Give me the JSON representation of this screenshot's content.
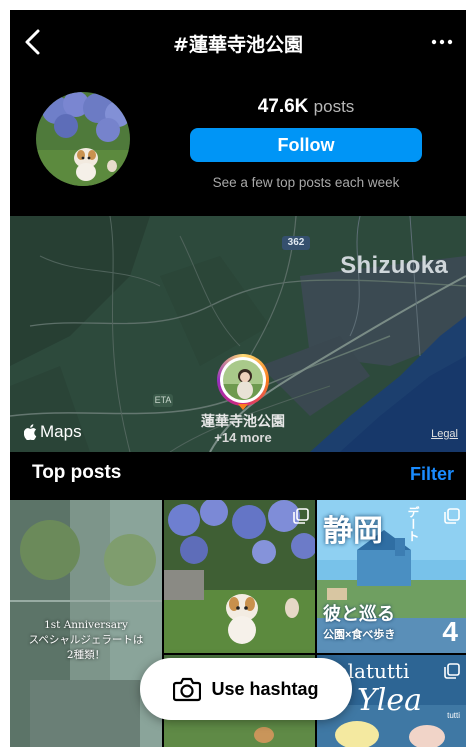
{
  "header": {
    "title": "#蓮華寺池公園",
    "back_icon": "chevron-left-icon",
    "more_icon": "more-horizontal-icon"
  },
  "profile": {
    "posts_count": "47.6K",
    "posts_label": "posts",
    "follow_label": "Follow",
    "follow_hint": "See a few top posts each week"
  },
  "map": {
    "city_label": "Shizuoka",
    "road_number": "362",
    "eta_label": "ETA",
    "place_name": "蓮華寺池公園",
    "place_more": "+14 more",
    "maps_label": "Maps",
    "legal_label": "Legal"
  },
  "top_posts": {
    "heading": "Top posts",
    "filter_label": "Filter",
    "tile1_text_line1": "1st Anniversary",
    "tile1_text_line2": "スペシャルジェラートは",
    "tile1_text_line3": "2種類！",
    "tile3_title": "静岡",
    "tile3_tag": "デート",
    "tile3_sub1": "彼と巡る",
    "tile3_sub2": "公園×食べ歩き",
    "tile3_num": "4",
    "tile5_title": "gelatutti",
    "tile5_script": "Ylea",
    "tile5_small": "tutti"
  },
  "cta": {
    "use_hashtag_label": "Use hashtag",
    "camera_icon": "camera-icon"
  },
  "colors": {
    "accent": "#0095f6",
    "filter_link": "#1a8cff",
    "background": "#000000"
  }
}
